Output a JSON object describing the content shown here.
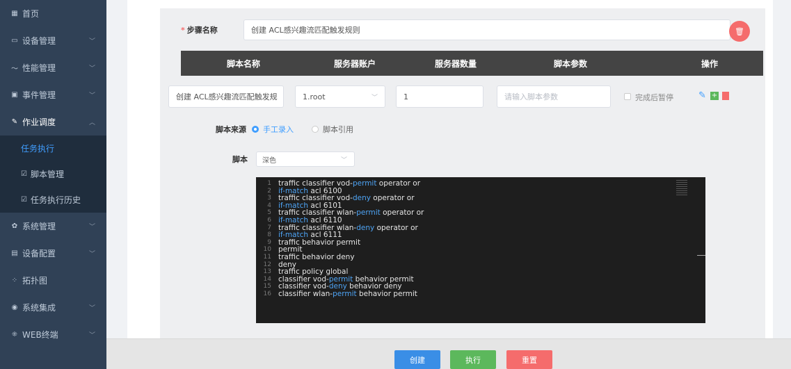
{
  "sidebar": {
    "items": [
      {
        "label": "首页",
        "icon": "grid-icon",
        "chevron": false
      },
      {
        "label": "设备管理",
        "icon": "monitor-icon",
        "chevron": true
      },
      {
        "label": "性能管理",
        "icon": "trend-icon",
        "chevron": true
      },
      {
        "label": "事件管理",
        "icon": "calendar-icon",
        "chevron": true
      },
      {
        "label": "作业调度",
        "icon": "pen-icon",
        "chevron": true,
        "open": true
      },
      {
        "label": "任务执行",
        "sub": true,
        "active": true
      },
      {
        "label": "脚本管理",
        "sub": true,
        "icon": "edit-icon"
      },
      {
        "label": "任务执行历史",
        "sub": true,
        "icon": "edit-icon"
      },
      {
        "label": "系统管理",
        "icon": "gear-icon",
        "chevron": true
      },
      {
        "label": "设备配置",
        "icon": "server-icon",
        "chevron": true
      },
      {
        "label": "拓扑图",
        "icon": "topology-icon",
        "chevron": false
      },
      {
        "label": "系统集成",
        "icon": "location-icon",
        "chevron": true
      },
      {
        "label": "WEB终端",
        "icon": "terminal-icon",
        "chevron": true
      }
    ]
  },
  "form": {
    "step_label": "步骤名称",
    "step_value": "创建 ACL感兴趣流匹配触发规则",
    "table_headers": [
      "脚本名称",
      "服务器账户",
      "服务器数量",
      "脚本参数",
      "操作"
    ],
    "row": {
      "script_name": "创建 ACL感兴趣流匹配触发规",
      "account": "1.root",
      "server_count": "1",
      "params_placeholder": "请输入脚本参数",
      "pause_label": "完成后暂停"
    },
    "source_label": "脚本来源",
    "source_options": [
      "手工录入",
      "脚本引用"
    ],
    "source_selected": 0,
    "script_label": "脚本",
    "theme_value": "深色"
  },
  "editor": {
    "lines": [
      [
        "traffic classifier vod-",
        "permit",
        " operator or"
      ],
      [
        "",
        "if-match",
        " acl 6100"
      ],
      [
        "traffic classifier vod-",
        "deny",
        " operator or"
      ],
      [
        "",
        "if-match",
        " acl 6101"
      ],
      [
        "traffic classifier wlan-",
        "permit",
        " operator or"
      ],
      [
        "",
        "if-match",
        " acl 6110"
      ],
      [
        "traffic classifier wlan-",
        "deny",
        " operator or"
      ],
      [
        "",
        "if-match",
        " acl 6111"
      ],
      [
        "traffic behavior permit",
        "",
        ""
      ],
      [
        "permit",
        "",
        ""
      ],
      [
        "traffic behavior deny",
        "",
        ""
      ],
      [
        "deny",
        "",
        ""
      ],
      [
        "traffic policy global",
        "",
        ""
      ],
      [
        "classifier vod-",
        "permit",
        " behavior permit"
      ],
      [
        "classifier vod-",
        "deny",
        " behavior deny"
      ],
      [
        "classifier wlan-",
        "permit",
        " behavior permit"
      ]
    ]
  },
  "buttons": {
    "create": "创建",
    "run": "执行",
    "reset": "重置"
  },
  "colors": {
    "sidebar_bg": "#304156",
    "accent": "#409eff",
    "keyword": "#4ea4f5",
    "danger": "#f56c6c",
    "success": "#5cb85c"
  }
}
